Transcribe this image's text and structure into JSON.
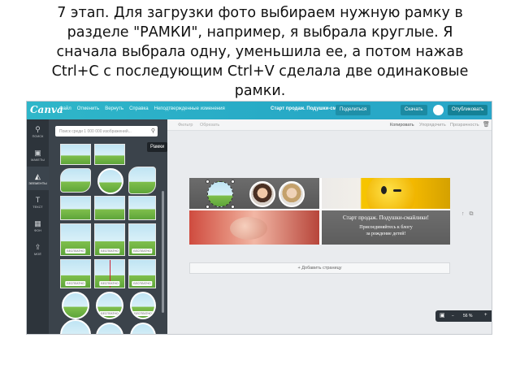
{
  "caption": {
    "line1": "7 этап. Для загрузки фото выбираем нужную рамку в",
    "line2": "разделе \"РАМКИ\", например, я выбрала круглые. Я",
    "line3": "сначала выбрала одну, уменьшила ее, а потом нажав",
    "line4": "Ctrl+C с последующим Ctrl+V сделала две одинаковые",
    "line5": "рамки."
  },
  "topbar": {
    "logo": "Canva",
    "menu": [
      "Файл",
      "Отменить",
      "Вернуть",
      "Справка",
      "Неподтвержденные изменения"
    ],
    "doc_title": "Старт продаж. Подушки-смайлики",
    "share_label": "Поделиться",
    "download_label": "Скачать",
    "publish_label": "Опубликовать",
    "accent_color": "#2fb6c9"
  },
  "rail": {
    "items": [
      {
        "icon": "search-icon",
        "label": "ПОИСК"
      },
      {
        "icon": "layout-icon",
        "label": "МАКЕТЫ"
      },
      {
        "icon": "elements-icon",
        "label": "ЭЛЕМЕНТЫ"
      },
      {
        "icon": "text-icon",
        "label": "ТЕКСТ"
      },
      {
        "icon": "background-icon",
        "label": "ФОН"
      },
      {
        "icon": "upload-icon",
        "label": "МОЁ"
      }
    ]
  },
  "panel": {
    "search_placeholder": "Поиск среди 1 000 000 изображений...",
    "tooltip": "Рамки",
    "badge": "БЕСПЛАТНО"
  },
  "canvas": {
    "subbar_left1": "Фильтр",
    "subbar_left2": "Обрезать",
    "copy_label": "Копировать",
    "arrange_label": "Упорядочить",
    "transparency_label": "Прозрачность",
    "text_line1": "Старт продаж. Подушки-смайлики!",
    "text_line2": "Присоединяйтесь к блогу",
    "text_line3": "за рождение детей!",
    "add_page_label": "+ Добавить страницу",
    "zoom_label": "56 %"
  }
}
